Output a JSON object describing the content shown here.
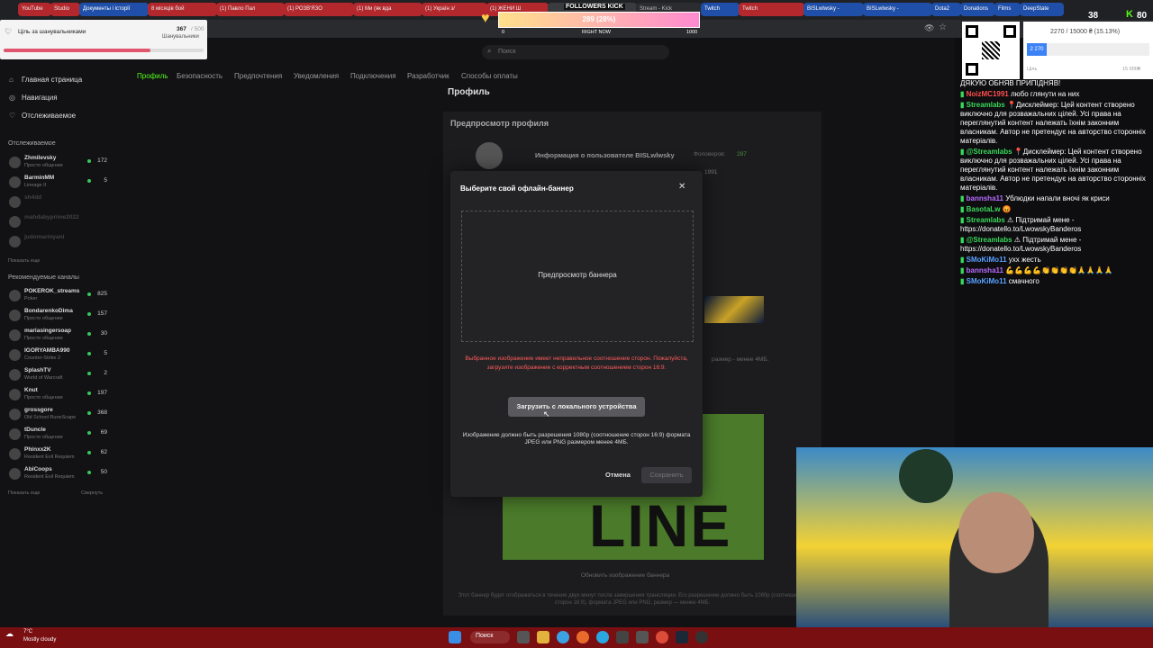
{
  "browser": {
    "tabs": [
      "YouTube",
      "Studio",
      "Документы і історії",
      "8 місяців бой",
      "(1) Павло Пал",
      "(1) РОЗВ'ЯЗО",
      "(1) Ми (як вда",
      "(1) Україн з/",
      "(1) ЖЕНИ Ш",
      "",
      "Stream - Kick",
      "Twitch",
      "Twitch",
      "BISLwlwsky -",
      "BISLwlwsky -",
      "Dota2",
      "Donations",
      "Films",
      "DeepState"
    ],
    "follow_widget": {
      "title": "FOLLOWERS KICK",
      "value": "289 (28%)",
      "min": "0",
      "mid": "RIGHT NOW",
      "max": "1000",
      "fill": 0.289
    }
  },
  "goal_widget": {
    "title": "Ціль за шанувальниками",
    "current": "367",
    "total": "/ 500",
    "subtitle": "Шанувальники",
    "fill": 0.734
  },
  "top_right": {
    "progress_text": "2270 / 15000 ₴ (15.13%)",
    "badge": "2 270",
    "left_label": "Ціль",
    "right_label": "15 000₴",
    "viewers": "38",
    "kick_count": "80"
  },
  "search": {
    "placeholder": "Поиск"
  },
  "sidebar": {
    "nav": [
      {
        "icon": "home-icon",
        "label": "Главная страница"
      },
      {
        "icon": "compass-icon",
        "label": "Навигация"
      },
      {
        "icon": "heart-icon",
        "label": "Отслеживаемое"
      }
    ],
    "followed_header": "Отслеживаемое",
    "followed": [
      {
        "name": "Zhmilevsky",
        "game": "Просто общение",
        "count": "172"
      },
      {
        "name": "BarminMM",
        "game": "Lineage II",
        "count": "5"
      },
      {
        "name": "sh4dd",
        "game": "",
        "count": ""
      },
      {
        "name": "mahdabyprime2022",
        "game": "",
        "count": ""
      },
      {
        "name": "judomarinyani",
        "game": "",
        "count": ""
      }
    ],
    "show_more_1": "Показать еще",
    "recommended_header": "Рекомендуемые каналы",
    "recommended": [
      {
        "name": "POKEROK_streams",
        "game": "Poker",
        "count": "825"
      },
      {
        "name": "BondarenkoDima",
        "game": "Просто общение",
        "count": "157"
      },
      {
        "name": "mariasingersoap",
        "game": "Просто общение",
        "count": "30"
      },
      {
        "name": "IGORYAMBA990",
        "game": "Counter-Strike 2",
        "count": "5"
      },
      {
        "name": "SplashTV",
        "game": "World of Warcraft",
        "count": "2"
      },
      {
        "name": "Knut",
        "game": "Просто общение",
        "count": "197"
      },
      {
        "name": "grossgore",
        "game": "Old School RuneScape",
        "count": "368"
      },
      {
        "name": "tDunclе",
        "game": "Просто общение",
        "count": "69"
      },
      {
        "name": "Phinxx2K",
        "game": "Resident Evil Requiem",
        "count": "62"
      },
      {
        "name": "AbiCoops",
        "game": "Resident Evil Requiem",
        "count": "50"
      }
    ],
    "show_more_2": "Показать еще",
    "collapse": "Свернуть"
  },
  "settings": {
    "tabs": [
      "Профиль",
      "Безопасность",
      "Предпочтения",
      "Уведомления",
      "Подключения",
      "Разработчик",
      "Способы оплаты"
    ],
    "page_title": "Профиль",
    "preview_title": "Предпросмотр профиля",
    "user_info": "Информация о пользователе BISLwlwsky",
    "followers_label": "Фоловеров:",
    "followers_count": "287",
    "year": "1991",
    "update_banner": "Обновить изображение баннера",
    "banner_note": "Этот баннер будет отображаться в течение двух минут после завершения трансляции. Его разрешение должно быть 1080р (соотношение сторон 16:9), формата JPEG или PNG, размер — менее 4МБ.",
    "size_note": "размер - менее 4МБ.",
    "banner_art": "LINE"
  },
  "modal": {
    "title": "Выберите свой офлайн-баннер",
    "preview_label": "Предпросмотр баннера",
    "error": "Выбранное изображение имеет неправильное соотношение сторон. Пожалуйста, загрузите изображение с корректным соотношением сторон 16:9.",
    "upload_button": "Загрузить с локального устройства",
    "hint": "Изображение должно быть разрешения 1080p (соотношение сторон 16:9) формата JPEG или PNG размером менее 4МБ.",
    "cancel": "Отмена",
    "save": "Сохранить"
  },
  "chat": {
    "messages": [
      {
        "user": "",
        "color": "#ffffff",
        "text": "ДЯКУЮ ОБНЯВ ПРИПІДНЯВ!"
      },
      {
        "user": "NoizMC1991",
        "color": "#ff4d4d",
        "text": "любо глянути на них"
      },
      {
        "user": "Streamlabs",
        "color": "#39d95b",
        "text": "📍Дисклеймер: Цей контент створено виключно для розважальних цілей. Усі права на переглянутий контент належать їхнім законним власникам. Автор не претендує на авторство сторонніх матеріалів."
      },
      {
        "user": "@Streamlabs",
        "color": "#39d95b",
        "text": "📍Дисклеймер: Цей контент створено виключно для розважальних цілей. Усі права на переглянутий контент належать їхнім законним власникам. Автор не претендує на авторство сторонніх матеріалів."
      },
      {
        "user": "bannsha11",
        "color": "#b76bff",
        "text": "Ублюдки напали вночі як криси"
      },
      {
        "user": "BasotaLw",
        "color": "#39d95b",
        "text": "😡"
      },
      {
        "user": "Streamlabs",
        "color": "#39d95b",
        "text": "⚠ Підтримай мене - https://donatello.to/LwowskyBanderos"
      },
      {
        "user": "@Streamlabs",
        "color": "#39d95b",
        "text": "⚠ Підтримай мене - https://donatello.to/LwowskyBanderos"
      },
      {
        "user": "SMoKiMo11",
        "color": "#5aa0ff",
        "text": "ухх жесть"
      },
      {
        "user": "bannsha11",
        "color": "#b76bff",
        "text": "💪💪💪💪👏👏👏👏🙏🙏🙏🙏"
      },
      {
        "user": "SMoKiMo11",
        "color": "#5aa0ff",
        "text": "смачного"
      }
    ]
  },
  "taskbar": {
    "weather_temp": "7°C",
    "weather_text": "Mostly cloudy",
    "search": "Поиск"
  },
  "colors": {
    "kick_green": "#53fc18",
    "error_red": "#ff5a5a",
    "taskbar": "#7a0f12"
  }
}
